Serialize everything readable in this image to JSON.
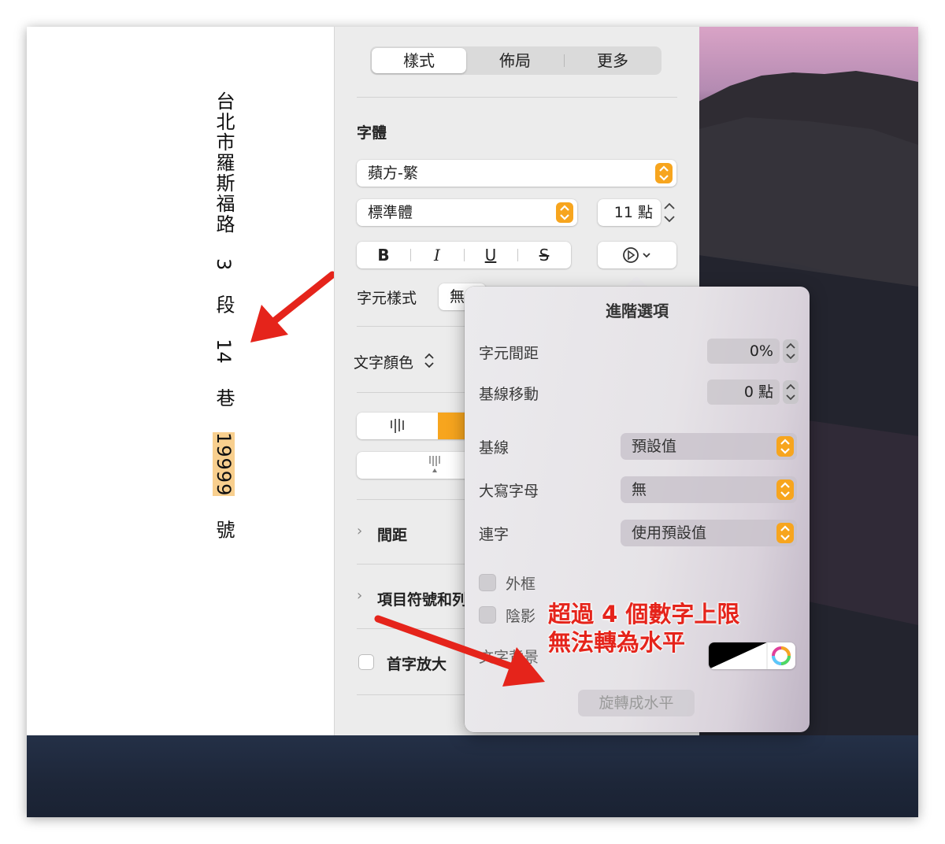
{
  "document": {
    "vertical_text_prefix": "台北市羅斯福路",
    "num1": "3",
    "char_duan": "段",
    "num2": "14",
    "char_xiang": "巷",
    "num3": "19999",
    "char_hao": "號"
  },
  "sidebar": {
    "tabs": [
      "樣式",
      "佈局",
      "更多"
    ],
    "font_section_title": "字體",
    "font_family": "蘋方-繁",
    "font_style": "標準體",
    "font_size": "11 點",
    "format_buttons": [
      "B",
      "I",
      "U",
      "S"
    ],
    "char_style_label": "字元樣式",
    "char_style_value": "無",
    "text_color_label": "文字顏色",
    "spacing_label": "間距",
    "bullets_label": "項目符號和列",
    "dropcap_label": "首字放大"
  },
  "advanced": {
    "title": "進階選項",
    "char_spacing_label": "字元間距",
    "char_spacing_value": "0%",
    "baseline_shift_label": "基線移動",
    "baseline_shift_value": "0 點",
    "baseline_label": "基線",
    "baseline_value": "預設值",
    "caps_label": "大寫字母",
    "caps_value": "無",
    "ligature_label": "連字",
    "ligature_value": "使用預設值",
    "outline_label": "外框",
    "shadow_label": "陰影",
    "text_bg_label": "文字背景",
    "rotate_button": "旋轉成水平"
  },
  "annotation": {
    "line1": "超過 4 個數字上限",
    "line2": "無法轉為水平"
  },
  "colors": {
    "accent": "#f7a51e",
    "highlight": "#f8cf8e",
    "annotation_red": "#e5241b"
  }
}
